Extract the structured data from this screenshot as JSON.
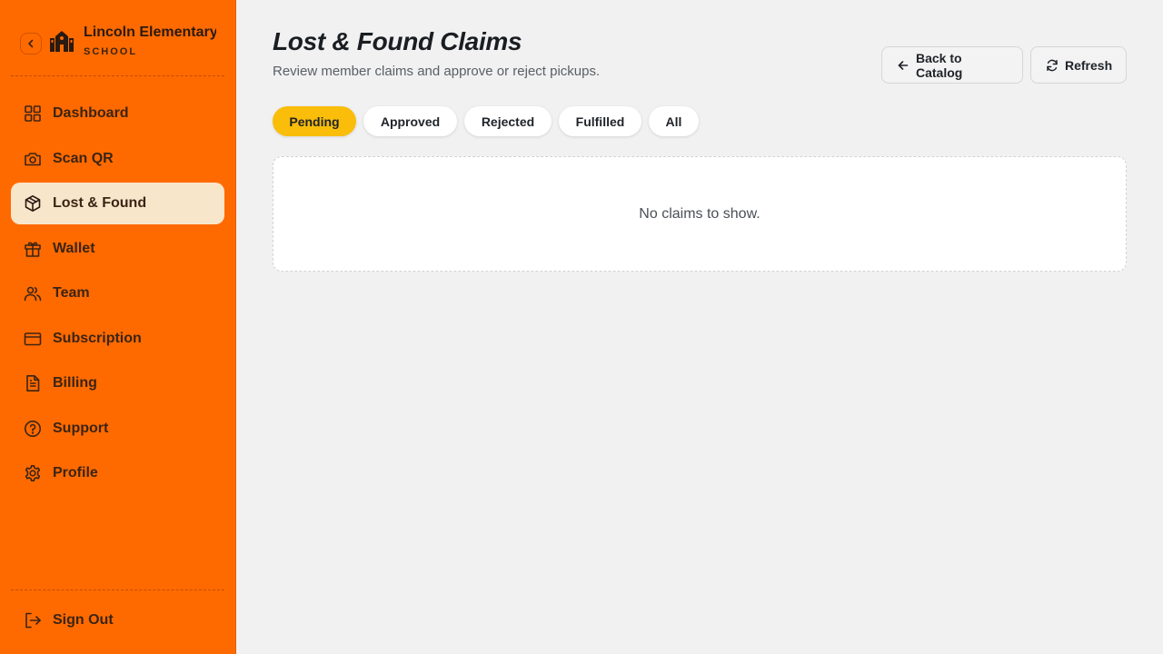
{
  "brand": {
    "name": "Lincoln Elementary",
    "type": "SCHOOL",
    "collapse_icon": "chevron-left-icon",
    "logo_icon": "school-icon"
  },
  "sidebar": {
    "items": [
      {
        "label": "Dashboard",
        "icon": "grid-icon",
        "active": false
      },
      {
        "label": "Scan QR",
        "icon": "camera-icon",
        "active": false
      },
      {
        "label": "Lost & Found",
        "icon": "package-icon",
        "active": true
      },
      {
        "label": "Wallet",
        "icon": "gift-icon",
        "active": false
      },
      {
        "label": "Team",
        "icon": "users-icon",
        "active": false
      },
      {
        "label": "Subscription",
        "icon": "credit-card-icon",
        "active": false
      },
      {
        "label": "Billing",
        "icon": "file-text-icon",
        "active": false
      },
      {
        "label": "Support",
        "icon": "help-circle-icon",
        "active": false
      },
      {
        "label": "Profile",
        "icon": "gear-icon",
        "active": false
      }
    ],
    "sign_out": {
      "label": "Sign Out",
      "icon": "log-out-icon"
    }
  },
  "header": {
    "title": "Lost & Found Claims",
    "subtitle": "Review member claims and approve or reject pickups.",
    "back_label": "Back to Catalog",
    "refresh_label": "Refresh"
  },
  "tabs": [
    {
      "label": "Pending",
      "active": true
    },
    {
      "label": "Approved",
      "active": false
    },
    {
      "label": "Rejected",
      "active": false
    },
    {
      "label": "Fulfilled",
      "active": false
    },
    {
      "label": "All",
      "active": false
    }
  ],
  "empty_state": {
    "message": "No claims to show."
  },
  "colors": {
    "sidebar_bg": "#ff6a00",
    "active_nav_bg": "#f8e6cb",
    "active_tab_bg": "#f9bd0a",
    "page_bg": "#f1f1f1"
  }
}
